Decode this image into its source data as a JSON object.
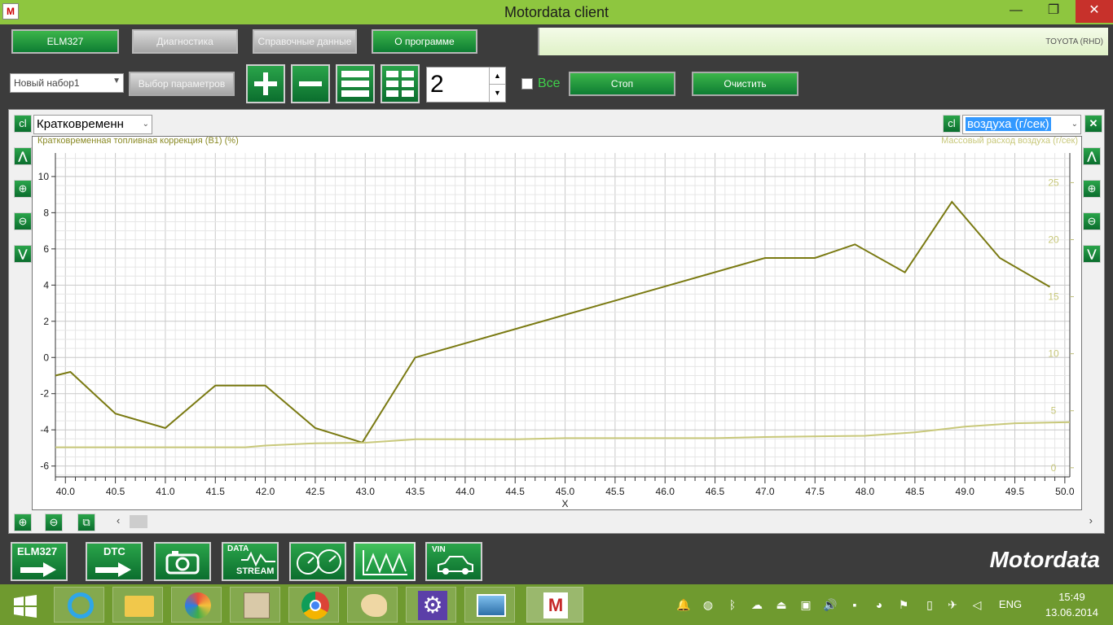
{
  "window": {
    "title": "Motordata client",
    "app_icon_letter": "M",
    "minimize_glyph": "—",
    "maximize_glyph": "❐",
    "close_glyph": "✕"
  },
  "menu": {
    "tabs": [
      {
        "label": "ELM327",
        "active": true
      },
      {
        "label": "Диагностика",
        "active": false
      },
      {
        "label": "Справочные данные",
        "active": false
      },
      {
        "label": "О программе",
        "active": true
      }
    ],
    "car_info": "TOYOTA (RHD)"
  },
  "toolbar": {
    "set_select": "Новый набор1",
    "param_select_button": "Выбор параметров",
    "count_value": "2",
    "all_checkbox_label": "Все",
    "all_checked": false,
    "stop_button": "Стоп",
    "clear_button": "Очистить",
    "icons": [
      "plus-icon",
      "minus-icon",
      "single-column-icon",
      "grid-icon"
    ]
  },
  "chart_panel": {
    "left_param_select": "Кратковременн",
    "right_param_select": "воздуха   (г/сек)",
    "cl_label": "cl"
  },
  "chart_data": {
    "type": "line",
    "xlabel": "X",
    "xlim": [
      39.9,
      50.05
    ],
    "x_ticks": [
      40.0,
      40.5,
      41.0,
      41.5,
      42.0,
      42.5,
      43.0,
      43.5,
      44.0,
      44.5,
      45.0,
      45.5,
      46.0,
      46.5,
      47.0,
      47.5,
      48.0,
      48.5,
      49.0,
      49.5,
      50.0
    ],
    "left_axis": {
      "label": "Кратковременная топливная коррекция (B1)   (%)",
      "ylim": [
        -6.6,
        11.3
      ],
      "ticks": [
        -6,
        -4,
        -2,
        0,
        2,
        4,
        6,
        8,
        10
      ]
    },
    "right_axis": {
      "label": "Массовый расход воздуха   (г/сек)",
      "ylim": [
        -0.8,
        27.6
      ],
      "ticks": [
        0,
        5,
        10,
        15,
        20,
        25
      ]
    },
    "grid": true,
    "series": [
      {
        "name": "Кратковременная топливная коррекция (B1)",
        "axis": "left",
        "color": "#7a7a12",
        "x": [
          39.9,
          40.05,
          40.5,
          41.0,
          41.5,
          42.0,
          42.5,
          42.97,
          43.5,
          47.0,
          47.5,
          47.9,
          48.4,
          48.87,
          49.35,
          49.85
        ],
        "y": [
          -1.0,
          -0.8,
          -3.1,
          -3.9,
          -1.55,
          -1.55,
          -3.9,
          -4.7,
          0.0,
          5.5,
          5.5,
          6.25,
          4.7,
          8.6,
          5.5,
          3.9
        ]
      },
      {
        "name": "Массовый расход воздуха",
        "axis": "right",
        "color": "#c8c87a",
        "x": [
          39.9,
          40.5,
          41.0,
          41.5,
          41.8,
          42.0,
          42.5,
          43.0,
          43.5,
          44.5,
          45.0,
          46.0,
          46.5,
          47.0,
          48.0,
          48.5,
          49.0,
          49.5,
          50.05
        ],
        "y": [
          1.8,
          1.8,
          1.8,
          1.8,
          1.8,
          1.95,
          2.15,
          2.2,
          2.5,
          2.5,
          2.6,
          2.6,
          2.6,
          2.7,
          2.8,
          3.1,
          3.6,
          3.9,
          4.0
        ]
      }
    ]
  },
  "bottom_nav": {
    "buttons": [
      {
        "label": "ELM327",
        "icon": "arrow-right-icon"
      },
      {
        "label": "DTC",
        "icon": "arrow-right-icon"
      },
      {
        "label": "",
        "icon": "camera-icon"
      },
      {
        "label": "DATA",
        "sublabel": "STREAM",
        "icon": "waveform-icon"
      },
      {
        "label": "",
        "icon": "gauges-icon"
      },
      {
        "label": "",
        "icon": "graph-icon"
      },
      {
        "label": "VIN",
        "icon": "car-icon"
      }
    ],
    "brand": "Motordata"
  },
  "taskbar": {
    "apps": [
      "start-icon",
      "ie-icon",
      "explorer-icon",
      "media-icon",
      "tools-icon",
      "chrome-icon",
      "paint-icon",
      "settings-icon",
      "photos-icon",
      "motordata-icon"
    ],
    "lang": "ENG",
    "time": "15:49",
    "date": "13.06.2014"
  }
}
